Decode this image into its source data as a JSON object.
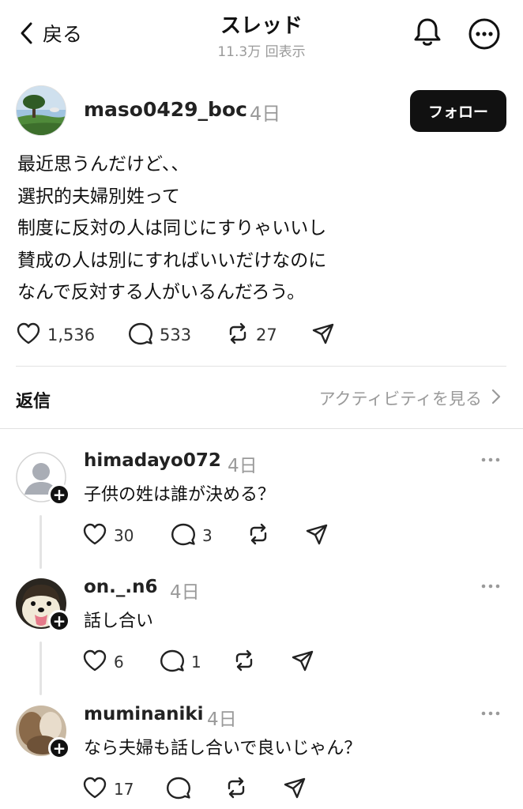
{
  "header": {
    "back_label": "戻る",
    "title": "スレッド",
    "views": "11.3万 回表示"
  },
  "post": {
    "username": "maso0429_boc",
    "age": "4日",
    "follow_label": "フォロー",
    "lines": [
      "最近思うんだけど、、",
      "選択的夫婦別姓って",
      "制度に反対の人は同じにすりゃいいし",
      "賛成の人は別にすればいいだけなのに",
      "なんで反対する人がいるんだろう。"
    ],
    "likes": "1,536",
    "comments": "533",
    "reposts": "27"
  },
  "replies_section": {
    "title": "返信",
    "activity_link": "アクティビティを見る"
  },
  "replies": [
    {
      "username": "himadayo072",
      "age": "4日",
      "text": "子供の姓は誰が決める？",
      "likes": "30",
      "comments": "3"
    },
    {
      "username": "on._.n6",
      "age": "4日",
      "text": "話し合い",
      "likes": "6",
      "comments": "1"
    },
    {
      "username": "muminaniki",
      "age": "4日",
      "text": "なら夫婦も話し合いで良いじゃん？",
      "likes": "17",
      "comments": ""
    }
  ],
  "icons": {
    "back": "chevron-left-icon",
    "notifications": "bell-icon",
    "more": "ellipsis-circle-icon",
    "like": "heart-icon",
    "comment": "speech-bubble-icon",
    "repost": "repost-icon",
    "share": "send-icon",
    "follow_add": "plus-icon"
  },
  "colors": {
    "text": "#111111",
    "muted": "#9a9a9a",
    "follow_bg": "#111111",
    "divider": "#e2e2e2"
  }
}
